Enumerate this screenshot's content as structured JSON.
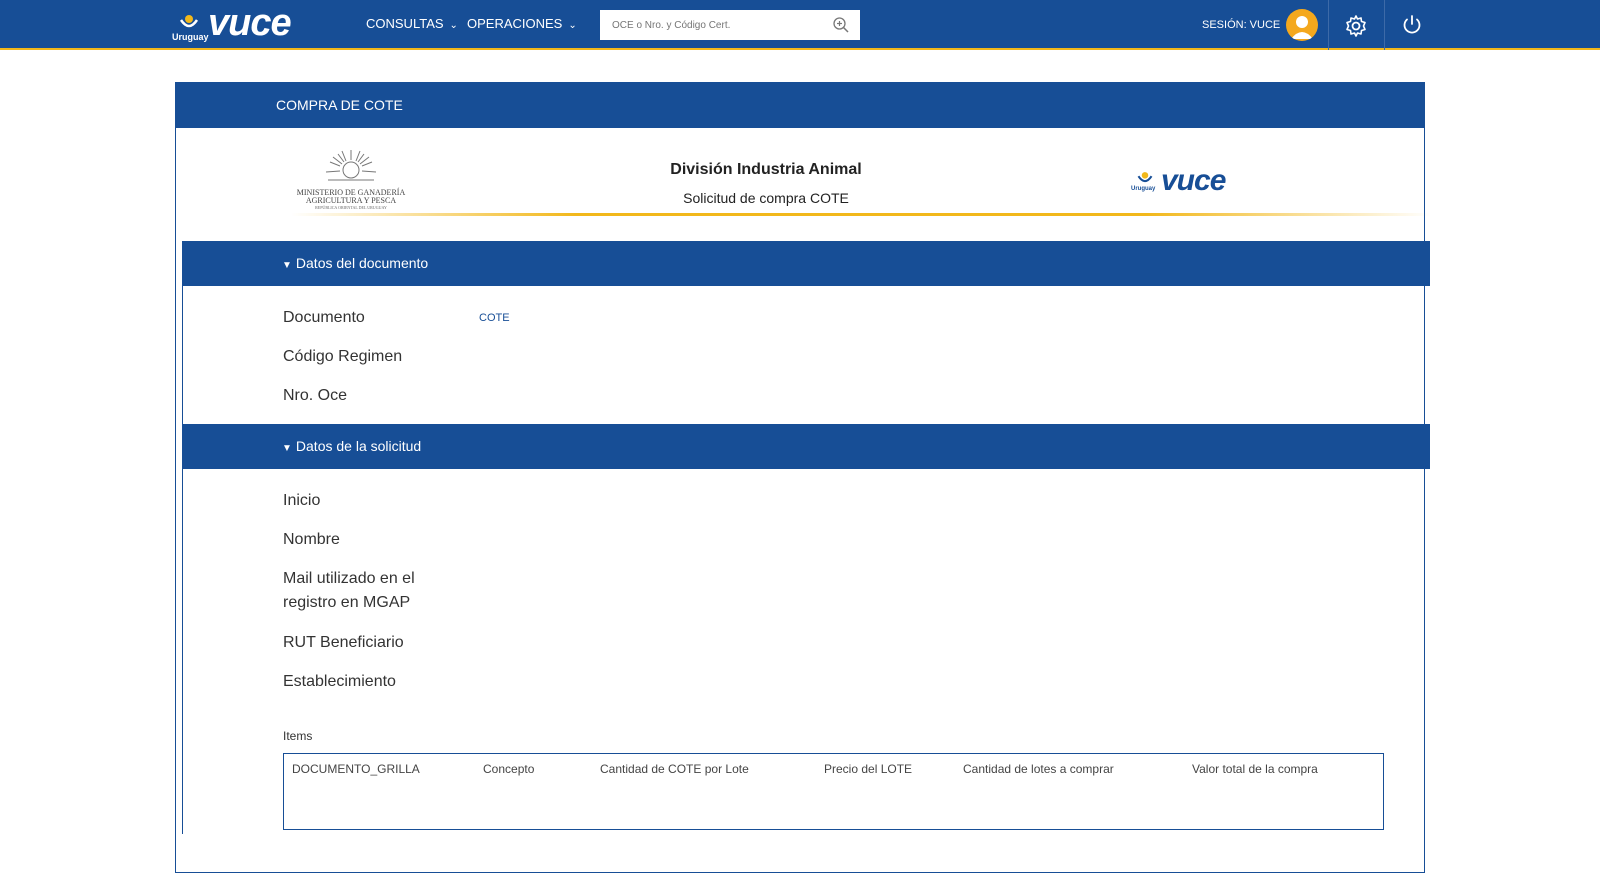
{
  "header": {
    "country": "Uruguay",
    "brand": "vuce",
    "nav": [
      "CONSULTAS",
      "OPERACIONES"
    ],
    "search_placeholder": "OCE o Nro. y Código Cert.",
    "session_label": "SESIÓN: VUCE"
  },
  "page": {
    "title": "COMPRA DE COTE",
    "ministry": {
      "line1": "MINISTERIO DE GANADERÍA",
      "line2": "AGRICULTURA Y PESCA",
      "line3": "REPÚBLICA ORIENTAL DEL URUGUAY"
    },
    "doc_title": "División Industria Animal",
    "doc_subtitle": "Solicitud de compra COTE",
    "vuce_country": "Uruguay",
    "vuce_brand": "vuce"
  },
  "section_document": {
    "title": "Datos del documento",
    "fields": [
      {
        "label": "Documento",
        "value": "COTE"
      },
      {
        "label": "Código Regimen",
        "value": ""
      },
      {
        "label": "Nro. Oce",
        "value": ""
      }
    ]
  },
  "section_request": {
    "title": "Datos de la solicitud",
    "fields": [
      {
        "label": "Inicio",
        "value": ""
      },
      {
        "label": "Nombre",
        "value": ""
      },
      {
        "label": "Mail utilizado en el registro en MGAP",
        "value": ""
      },
      {
        "label": "RUT Beneficiario",
        "value": ""
      },
      {
        "label": "Establecimiento",
        "value": ""
      }
    ],
    "items_label": "Items",
    "grid_columns": [
      "DOCUMENTO_GRILLA",
      "Concepto",
      "Cantidad de COTE por Lote",
      "Precio del LOTE",
      "Cantidad de lotes a comprar",
      "Valor total de la compra"
    ]
  },
  "colors": {
    "primary": "#174e96",
    "accent": "#f2b81b",
    "avatar": "#f4a81d"
  }
}
